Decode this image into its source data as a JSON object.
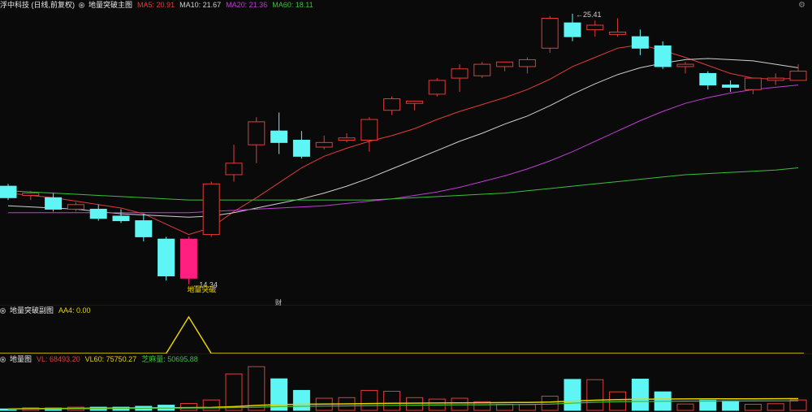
{
  "main": {
    "stock_title": "浮中科技 (日线,前复权)",
    "indicator": "地量突破主图",
    "ma": [
      {
        "label": "MA5:",
        "value": "20.91",
        "color": "#e23b3b"
      },
      {
        "label": "MA10:",
        "value": "21.67",
        "color": "#cfcfcf"
      },
      {
        "label": "MA20:",
        "value": "21.36",
        "color": "#c23bd6"
      },
      {
        "label": "MA60:",
        "value": "18.11",
        "color": "#3bbf3b"
      }
    ],
    "high_label": "25.41",
    "low_label": "14.34",
    "signal_label": "地量突破",
    "marker": "财"
  },
  "sub1": {
    "indicator": "地量突破副图",
    "line_label": "AA4:",
    "line_value": "0.00",
    "line_color": "#e6d200"
  },
  "sub2": {
    "indicator": "地量图",
    "values": [
      {
        "label": "VL:",
        "value": "68493.20",
        "color": "#e23b3b"
      },
      {
        "label": "VL60:",
        "value": "75750.27",
        "color": "#e6d200"
      },
      {
        "label": "芝麻量:",
        "value": "50695.88",
        "color": "#3bbf3b"
      }
    ]
  },
  "colors": {
    "up": "#e23b3b",
    "down": "#5ef5f5",
    "signal": "#ff1f80",
    "ma5": "#e23b3b",
    "ma10": "#cfcfcf",
    "ma20": "#c23bd6",
    "ma60": "#3bbf3b",
    "vol_yellow": "#e6d200",
    "vol_green": "#3bbf3b"
  },
  "chart_data": {
    "type": "candlestick",
    "price_range": [
      13.8,
      26.2
    ],
    "candles": [
      {
        "o": 18.6,
        "h": 18.7,
        "l": 18.0,
        "c": 18.1
      },
      {
        "o": 18.2,
        "h": 18.4,
        "l": 18.0,
        "c": 18.3
      },
      {
        "o": 18.1,
        "h": 18.3,
        "l": 17.5,
        "c": 17.6
      },
      {
        "o": 17.6,
        "h": 17.9,
        "l": 17.5,
        "c": 17.8
      },
      {
        "o": 17.6,
        "h": 17.8,
        "l": 17.1,
        "c": 17.2
      },
      {
        "o": 17.3,
        "h": 17.6,
        "l": 17.0,
        "c": 17.1
      },
      {
        "o": 17.1,
        "h": 17.4,
        "l": 16.2,
        "c": 16.4
      },
      {
        "o": 16.3,
        "h": 16.4,
        "l": 14.5,
        "c": 14.7
      },
      {
        "o": 14.6,
        "h": 16.4,
        "l": 14.34,
        "c": 16.3
      },
      {
        "o": 16.5,
        "h": 18.8,
        "l": 16.4,
        "c": 18.7
      },
      {
        "o": 19.1,
        "h": 20.4,
        "l": 18.8,
        "c": 19.6
      },
      {
        "o": 20.4,
        "h": 21.6,
        "l": 19.6,
        "c": 21.4
      },
      {
        "o": 21.0,
        "h": 21.8,
        "l": 20.0,
        "c": 20.5
      },
      {
        "o": 20.6,
        "h": 21.0,
        "l": 19.8,
        "c": 19.9
      },
      {
        "o": 20.3,
        "h": 20.8,
        "l": 20.2,
        "c": 20.5
      },
      {
        "o": 20.6,
        "h": 20.9,
        "l": 20.5,
        "c": 20.7
      },
      {
        "o": 20.6,
        "h": 21.6,
        "l": 20.1,
        "c": 21.5
      },
      {
        "o": 21.9,
        "h": 22.5,
        "l": 21.7,
        "c": 22.4
      },
      {
        "o": 22.2,
        "h": 22.3,
        "l": 21.9,
        "c": 22.3
      },
      {
        "o": 22.6,
        "h": 23.3,
        "l": 22.5,
        "c": 23.2
      },
      {
        "o": 23.3,
        "h": 23.9,
        "l": 22.7,
        "c": 23.7
      },
      {
        "o": 23.4,
        "h": 24.0,
        "l": 23.3,
        "c": 23.9
      },
      {
        "o": 23.8,
        "h": 24.0,
        "l": 23.6,
        "c": 24.0
      },
      {
        "o": 23.8,
        "h": 24.2,
        "l": 23.5,
        "c": 24.1
      },
      {
        "o": 24.6,
        "h": 26.0,
        "l": 24.4,
        "c": 25.9
      },
      {
        "o": 25.7,
        "h": 26.1,
        "l": 24.9,
        "c": 25.1
      },
      {
        "o": 25.4,
        "h": 25.8,
        "l": 25.1,
        "c": 25.6
      },
      {
        "o": 25.2,
        "h": 25.9,
        "l": 25.1,
        "c": 25.3
      },
      {
        "o": 25.1,
        "h": 25.41,
        "l": 24.3,
        "c": 24.6
      },
      {
        "o": 24.7,
        "h": 24.9,
        "l": 23.7,
        "c": 23.8
      },
      {
        "o": 23.8,
        "h": 24.0,
        "l": 23.5,
        "c": 23.9
      },
      {
        "o": 23.5,
        "h": 23.6,
        "l": 22.8,
        "c": 23.0
      },
      {
        "o": 23.0,
        "h": 23.2,
        "l": 22.7,
        "c": 22.9
      },
      {
        "o": 22.8,
        "h": 23.3,
        "l": 22.6,
        "c": 23.3
      },
      {
        "o": 23.2,
        "h": 23.5,
        "l": 23.0,
        "c": 23.3
      },
      {
        "o": 23.2,
        "h": 23.9,
        "l": 23.2,
        "c": 23.6
      }
    ],
    "signal_index": 8,
    "ma_lines": {
      "MA5": [
        18.3,
        18.2,
        18.1,
        17.95,
        17.8,
        17.65,
        17.4,
        16.95,
        16.5,
        16.8,
        17.5,
        18.1,
        18.75,
        19.4,
        19.9,
        20.25,
        20.55,
        20.8,
        21.1,
        21.5,
        21.85,
        22.15,
        22.45,
        22.8,
        23.25,
        23.8,
        24.2,
        24.6,
        24.75,
        24.5,
        24.2,
        23.85,
        23.5,
        23.3,
        23.25,
        23.3
      ],
      "MA10": [
        17.75,
        17.7,
        17.65,
        17.6,
        17.5,
        17.4,
        17.35,
        17.3,
        17.25,
        17.3,
        17.45,
        17.65,
        17.85,
        18.05,
        18.3,
        18.6,
        18.95,
        19.35,
        19.75,
        20.15,
        20.55,
        20.9,
        21.3,
        21.65,
        22.1,
        22.6,
        23.05,
        23.45,
        23.75,
        23.95,
        24.1,
        24.15,
        24.1,
        24.05,
        23.9,
        23.75
      ],
      "MA20": [
        17.45,
        17.45,
        17.45,
        17.45,
        17.45,
        17.45,
        17.45,
        17.45,
        17.45,
        17.5,
        17.55,
        17.6,
        17.65,
        17.7,
        17.75,
        17.85,
        17.95,
        18.05,
        18.2,
        18.35,
        18.55,
        18.8,
        19.05,
        19.35,
        19.7,
        20.1,
        20.55,
        21.0,
        21.45,
        21.85,
        22.2,
        22.45,
        22.65,
        22.8,
        22.9,
        23.0
      ],
      "MA60": [
        18.4,
        18.35,
        18.3,
        18.25,
        18.2,
        18.15,
        18.1,
        18.05,
        18.0,
        18.0,
        18.0,
        18.0,
        18.0,
        18.0,
        18.0,
        18.0,
        18.0,
        18.05,
        18.1,
        18.15,
        18.2,
        18.25,
        18.3,
        18.4,
        18.5,
        18.6,
        18.7,
        18.8,
        18.9,
        19.0,
        19.1,
        19.15,
        19.2,
        19.25,
        19.3,
        19.4
      ]
    },
    "aa4": [
      0,
      0,
      0,
      0,
      0,
      0,
      0,
      0,
      1,
      0,
      0,
      0,
      0,
      0,
      0,
      0,
      0,
      0,
      0,
      0,
      0,
      0,
      0,
      0,
      0,
      0,
      0,
      0,
      0,
      0,
      0,
      0,
      0,
      0,
      0,
      0
    ],
    "volume": [
      5000,
      9000,
      8000,
      11000,
      11000,
      11000,
      14000,
      18000,
      24000,
      36000,
      126000,
      151000,
      109000,
      69000,
      42000,
      44000,
      69000,
      66000,
      44000,
      39000,
      42000,
      30000,
      21000,
      20000,
      49000,
      107000,
      106000,
      64000,
      108000,
      64000,
      22000,
      35000,
      33000,
      21000,
      23000,
      36000
    ],
    "volume_range": [
      0,
      160000
    ],
    "vl60_line": [
      5000,
      6000,
      6500,
      7000,
      7500,
      8000,
      8500,
      9000,
      9500,
      10000,
      13000,
      17000,
      20000,
      21000,
      22000,
      22500,
      23500,
      24500,
      25000,
      25500,
      26000,
      26500,
      27000,
      27500,
      28500,
      32000,
      35000,
      37000,
      38500,
      39000,
      39500,
      39800,
      40000,
      40200,
      40400,
      40600
    ],
    "zhima_line": [
      4000,
      4500,
      5000,
      5500,
      6000,
      6500,
      7000,
      7500,
      8000,
      8500,
      9500,
      11000,
      13000,
      14000,
      15000,
      15500,
      16500,
      17500,
      18000,
      18500,
      19000,
      19500,
      20000,
      20500,
      21500,
      25000,
      28000,
      30000,
      31000,
      31500,
      32000,
      32200,
      32400,
      32600,
      32800,
      33000
    ]
  }
}
